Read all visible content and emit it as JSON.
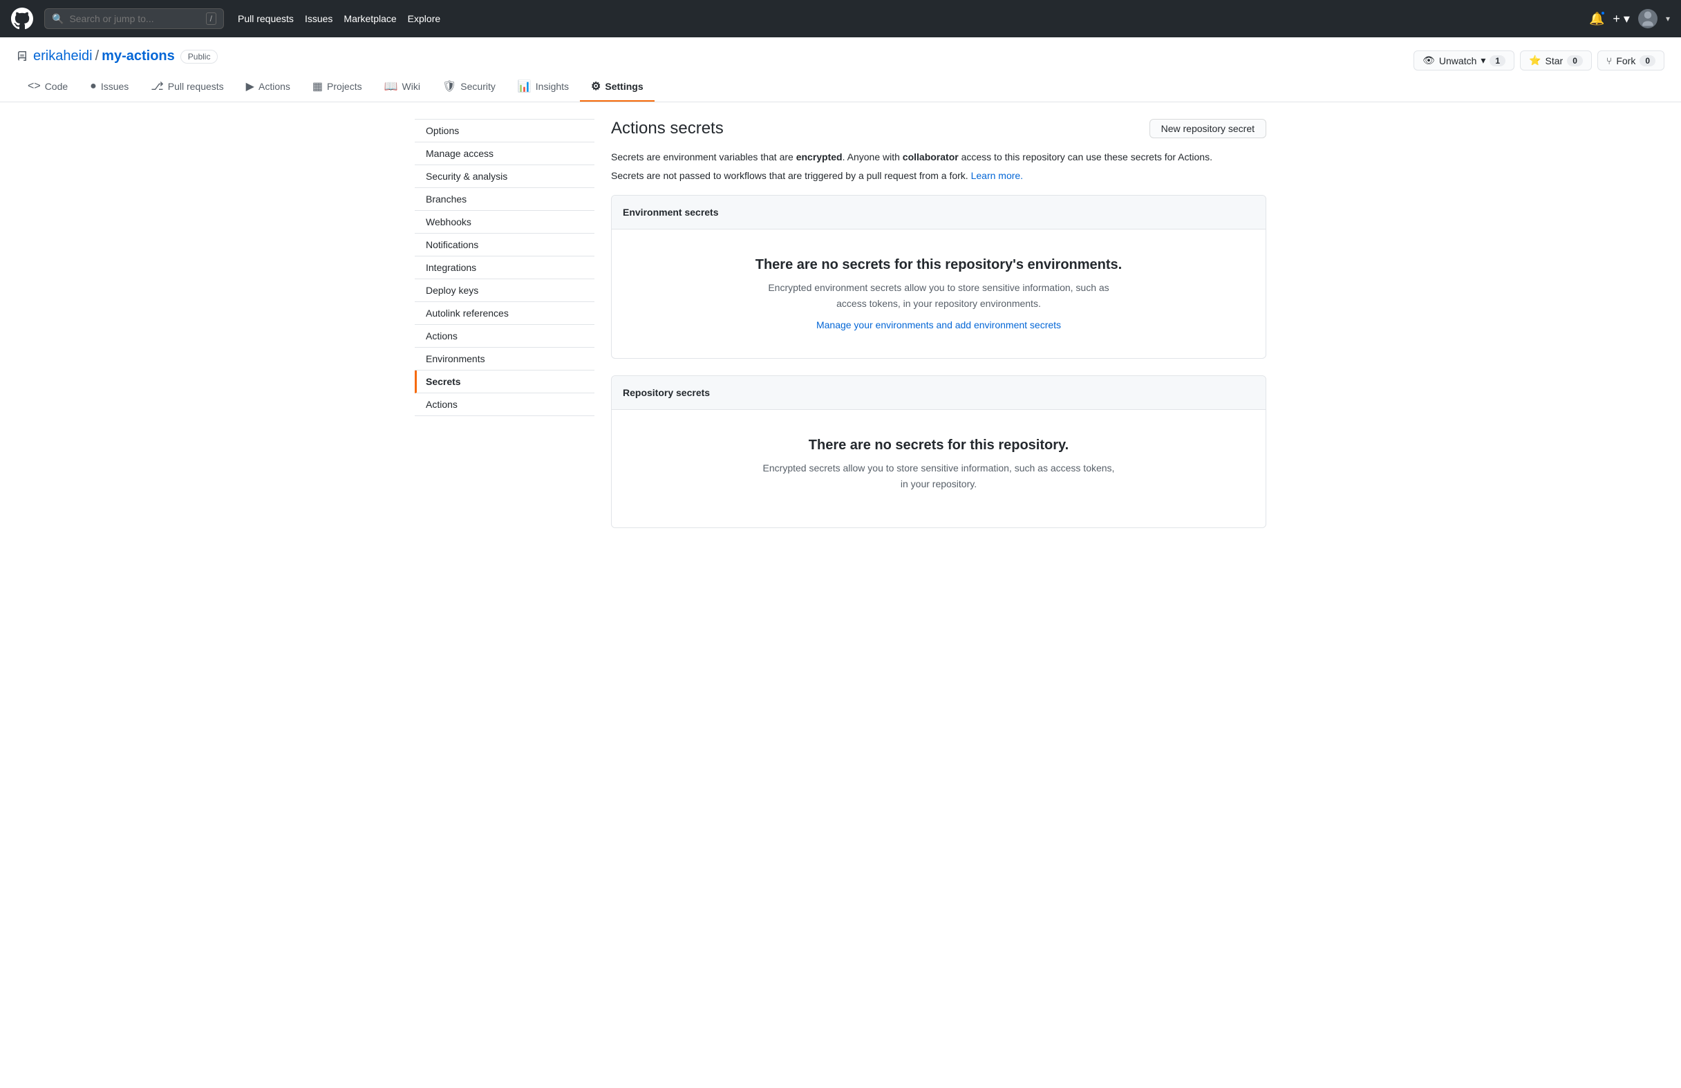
{
  "topnav": {
    "search_placeholder": "Search or jump to...",
    "search_slash": "/",
    "links": [
      {
        "label": "Pull requests",
        "id": "pull-requests"
      },
      {
        "label": "Issues",
        "id": "issues"
      },
      {
        "label": "Marketplace",
        "id": "marketplace"
      },
      {
        "label": "Explore",
        "id": "explore"
      }
    ]
  },
  "repo": {
    "owner": "erikaheidi",
    "name": "my-actions",
    "visibility": "Public",
    "unwatch_label": "Unwatch",
    "unwatch_count": "1",
    "star_label": "Star",
    "star_count": "0",
    "fork_label": "Fork",
    "fork_count": "0"
  },
  "repo_nav": [
    {
      "label": "Code",
      "icon": "<>",
      "id": "code",
      "active": false
    },
    {
      "label": "Issues",
      "icon": "●",
      "id": "issues",
      "active": false
    },
    {
      "label": "Pull requests",
      "icon": "⎇",
      "id": "pull-requests",
      "active": false
    },
    {
      "label": "Actions",
      "icon": "▶",
      "id": "actions",
      "active": false
    },
    {
      "label": "Projects",
      "icon": "▦",
      "id": "projects",
      "active": false
    },
    {
      "label": "Wiki",
      "icon": "📖",
      "id": "wiki",
      "active": false
    },
    {
      "label": "Security",
      "icon": "🛡",
      "id": "security",
      "active": false
    },
    {
      "label": "Insights",
      "icon": "📊",
      "id": "insights",
      "active": false
    },
    {
      "label": "Settings",
      "icon": "⚙",
      "id": "settings",
      "active": true
    }
  ],
  "sidebar": {
    "items": [
      {
        "label": "Options",
        "id": "options",
        "active": false
      },
      {
        "label": "Manage access",
        "id": "manage-access",
        "active": false
      },
      {
        "label": "Security & analysis",
        "id": "security-analysis",
        "active": false
      },
      {
        "label": "Branches",
        "id": "branches",
        "active": false
      },
      {
        "label": "Webhooks",
        "id": "webhooks",
        "active": false
      },
      {
        "label": "Notifications",
        "id": "notifications",
        "active": false
      },
      {
        "label": "Integrations",
        "id": "integrations",
        "active": false
      },
      {
        "label": "Deploy keys",
        "id": "deploy-keys",
        "active": false
      },
      {
        "label": "Autolink references",
        "id": "autolink-references",
        "active": false
      },
      {
        "label": "Actions",
        "id": "actions",
        "active": false
      },
      {
        "label": "Environments",
        "id": "environments",
        "active": false
      },
      {
        "label": "Secrets",
        "id": "secrets",
        "active": true
      },
      {
        "label": "Actions",
        "id": "actions-2",
        "active": false
      }
    ]
  },
  "content": {
    "page_title": "Actions secrets",
    "new_secret_button": "New repository secret",
    "description": {
      "main": "Secrets are environment variables that are encrypted. Anyone with collaborator access to this repository can use these secrets for Actions.",
      "note": "Secrets are not passed to workflows that are triggered by a pull request from a fork.",
      "learn_more": "Learn more.",
      "encrypted_bold": "encrypted",
      "collaborator_bold": "collaborator"
    },
    "environment_secrets": {
      "header": "Environment secrets",
      "empty_title": "There are no secrets for this repository's environments.",
      "empty_desc": "Encrypted environment secrets allow you to store sensitive information, such as access tokens, in your repository environments.",
      "empty_link_label": "Manage your environments and add environment secrets"
    },
    "repository_secrets": {
      "header": "Repository secrets",
      "empty_title": "There are no secrets for this repository.",
      "empty_desc": "Encrypted secrets allow you to store sensitive information, such as access tokens, in your repository."
    }
  }
}
